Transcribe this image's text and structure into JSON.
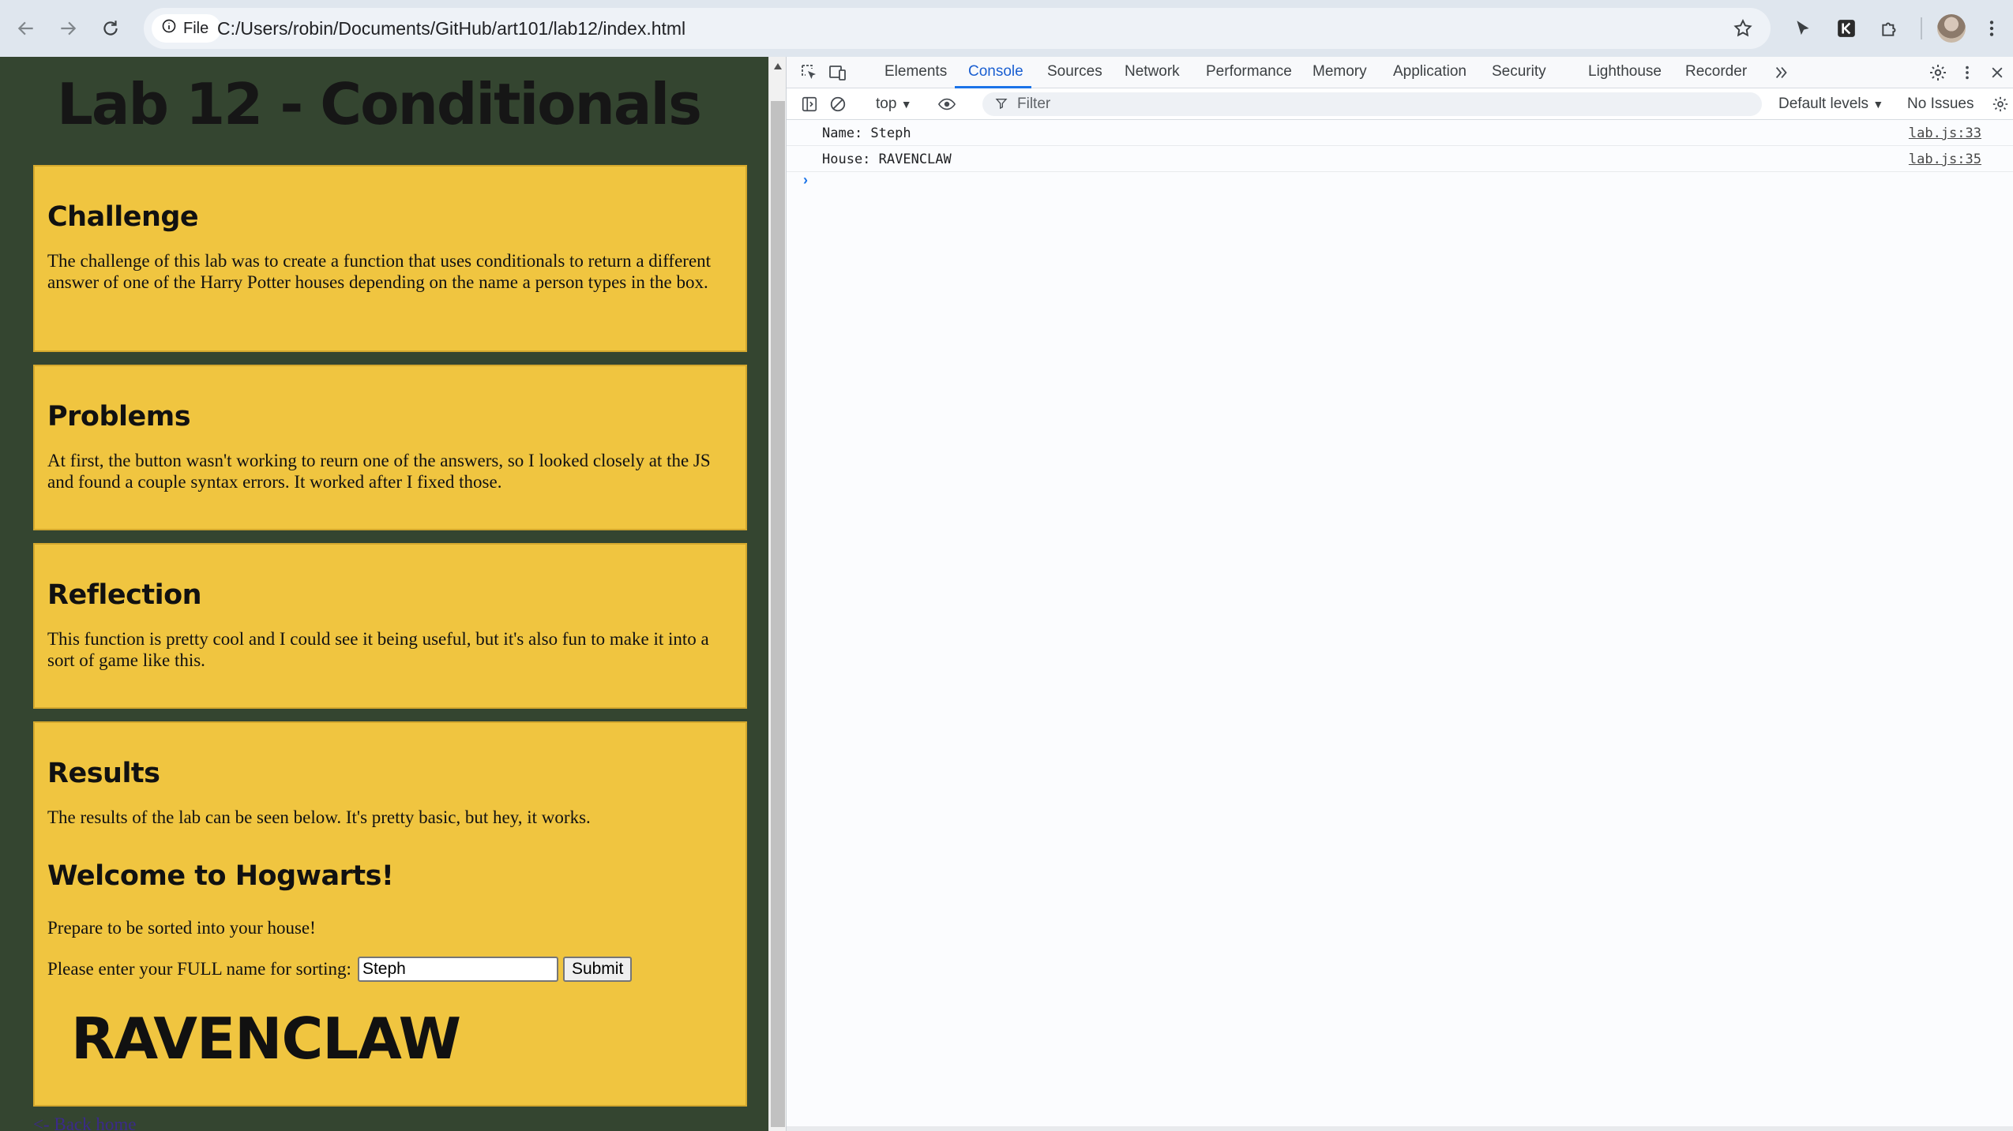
{
  "browser": {
    "site_chip_label": "File",
    "url": "C:/Users/robin/Documents/GitHub/art101/lab12/index.html"
  },
  "page": {
    "title": "Lab 12 - Conditionals",
    "sections": {
      "challenge": {
        "heading": "Challenge",
        "body": "The challenge of this lab was to create a function that uses conditionals to return a different answer of one of the Harry Potter houses depending on the name a person types in the box."
      },
      "problems": {
        "heading": "Problems",
        "body": "At first, the button wasn't working to reurn one of the answers, so I looked closely at the JS and found a couple syntax errors. It worked after I fixed those."
      },
      "reflection": {
        "heading": "Reflection",
        "body": "This function is pretty cool and I could see it being useful, but it's also fun to make it into a sort of game like this."
      },
      "results": {
        "heading": "Results",
        "body": "The results of the lab can be seen below. It's pretty basic, but hey, it works.",
        "welcome_heading": "Welcome to Hogwarts!",
        "prepare_text": "Prepare to be sorted into your house!",
        "prompt_label": "Please enter your FULL name for sorting:",
        "name_value": "Steph",
        "submit_label": "Submit",
        "house": "RAVENCLAW"
      }
    },
    "back_link": "<- Back home"
  },
  "devtools": {
    "tabs": [
      {
        "label": "Elements",
        "active": false
      },
      {
        "label": "Console",
        "active": true
      },
      {
        "label": "Sources",
        "active": false
      },
      {
        "label": "Network",
        "active": false
      },
      {
        "label": "Performance",
        "active": false
      },
      {
        "label": "Memory",
        "active": false
      },
      {
        "label": "Application",
        "active": false
      },
      {
        "label": "Security",
        "active": false
      },
      {
        "label": "Lighthouse",
        "active": false
      },
      {
        "label": "Recorder",
        "active": false
      }
    ],
    "context": "top",
    "filter_placeholder": "Filter",
    "levels": "Default levels",
    "issues": "No Issues",
    "logs": [
      {
        "message": "Name: Steph",
        "source": "lab.js:33"
      },
      {
        "message": "House: RAVENCLAW",
        "source": "lab.js:35"
      }
    ]
  },
  "colors": {
    "page_background": "#344530",
    "panel_background": "#f0c540",
    "devtools_accent": "#1a73e8"
  }
}
